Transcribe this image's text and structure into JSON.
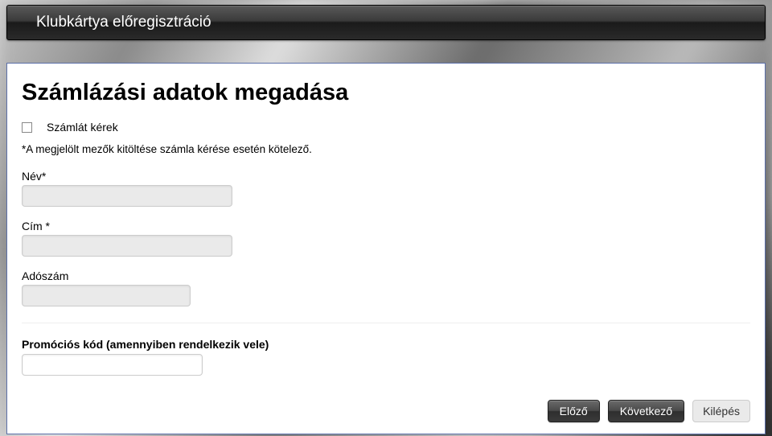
{
  "header": {
    "title": "Klubkártya előregisztráció"
  },
  "page": {
    "title": "Számlázási adatok megadása",
    "request_invoice_label": "Számlát kérek",
    "hint": "*A megjelölt mezők kitöltése számla kérése esetén kötelező."
  },
  "fields": {
    "name": {
      "label": "Név*",
      "value": ""
    },
    "address": {
      "label": "Cím *",
      "value": ""
    },
    "taxnum": {
      "label": "Adószám",
      "value": ""
    },
    "promo": {
      "label": "Promóciós kód (amennyiben rendelkezik vele)",
      "value": ""
    }
  },
  "buttons": {
    "prev": "Előző",
    "next": "Következő",
    "exit": "Kilépés"
  }
}
